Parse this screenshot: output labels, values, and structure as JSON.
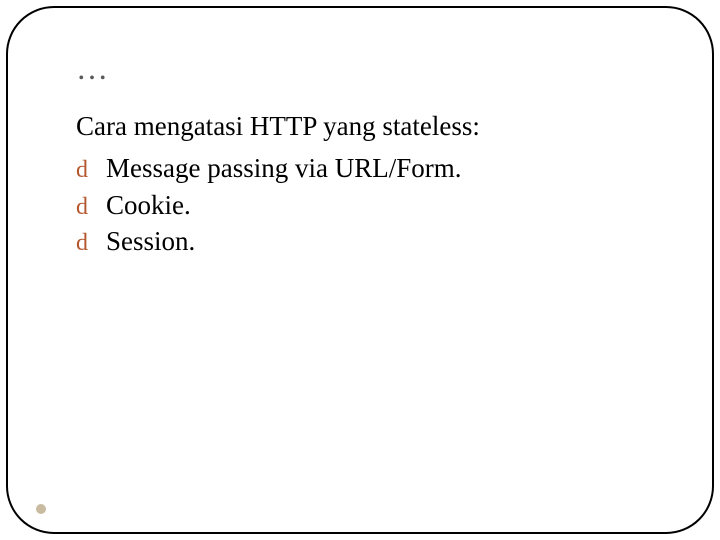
{
  "slide": {
    "title": "…",
    "intro": "Cara mengatasi HTTP yang stateless:",
    "bullet_glyph": "d",
    "items": [
      "Message passing via URL/Form.",
      "Cookie.",
      "Session."
    ]
  }
}
